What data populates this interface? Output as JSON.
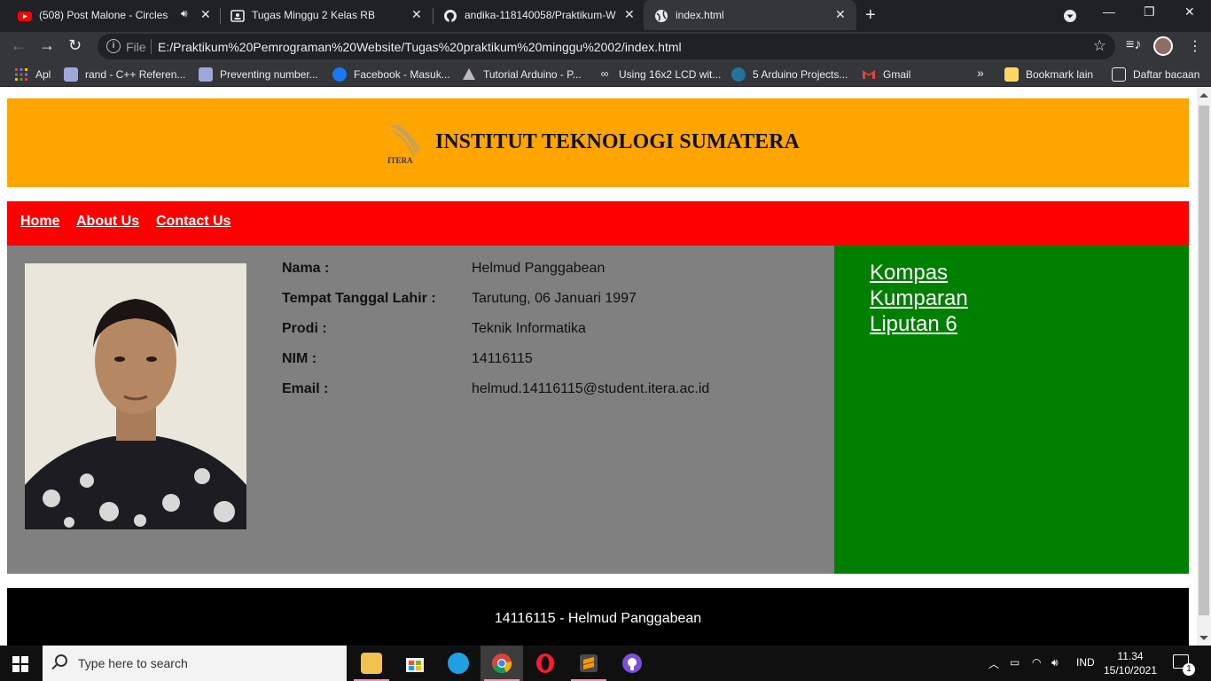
{
  "browser": {
    "tabs": [
      {
        "title": "(508) Post Malone - Circles -",
        "icon": "youtube-icon",
        "audio": true
      },
      {
        "title": "Tugas Minggu 2 Kelas RB",
        "icon": "classroom-icon"
      },
      {
        "title": "andika-118140058/Praktikum-W",
        "icon": "github-icon"
      },
      {
        "title": "index.html",
        "icon": "globe-icon",
        "active": true
      }
    ],
    "omnibox": {
      "scheme": "File",
      "url": "E:/Praktikum%20Pemrograman%20Website/Tugas%20praktikum%20minggu%2002/index.html"
    },
    "bookmarks": [
      {
        "label": "Apl",
        "icon": "apps-grid-icon"
      },
      {
        "label": "rand - C++ Referen...",
        "icon": "cplusplus-icon"
      },
      {
        "label": "Preventing number...",
        "icon": "cplusplus-icon"
      },
      {
        "label": "Facebook - Masuk...",
        "icon": "facebook-icon"
      },
      {
        "label": "Tutorial Arduino - P...",
        "icon": "arduino-icon"
      },
      {
        "label": "Using 16x2 LCD wit...",
        "icon": "link-icon"
      },
      {
        "label": "5 Arduino Projects...",
        "icon": "wordpress-icon"
      },
      {
        "label": "Gmail",
        "icon": "gmail-icon"
      }
    ],
    "bookmarks_overflow": "»",
    "bookmark_folder": "Bookmark lain",
    "reading_list": "Daftar bacaan"
  },
  "page": {
    "header_title": "INSTITUT TEKNOLOGI SUMATERA",
    "logo_text": "ITERA",
    "nav": [
      "Home",
      "About Us",
      "Contact Us"
    ],
    "bio": [
      {
        "label": "Nama :",
        "value": "Helmud Panggabean"
      },
      {
        "label": "Tempat Tanggal Lahir :",
        "value": "Tarutung, 06 Januari 1997"
      },
      {
        "label": "Prodi :",
        "value": "Teknik Informatika"
      },
      {
        "label": "NIM :",
        "value": "14116115"
      },
      {
        "label": "Email :",
        "value": "helmud.14116115@student.itera.ac.id"
      }
    ],
    "links": [
      "Kompas",
      "Kumparan",
      "Liputan 6"
    ],
    "footer": "14116115 - Helmud Panggabean",
    "colors": {
      "header": "#ffa500",
      "nav": "#ff0000",
      "main": "#808080",
      "aside": "#008000",
      "footer": "#000000"
    }
  },
  "taskbar": {
    "search_placeholder": "Type here to search",
    "apps": [
      "file-explorer-icon",
      "store-icon",
      "edge-icon",
      "chrome-icon",
      "opera-icon",
      "sublime-text-icon",
      "github-desktop-icon"
    ],
    "language": "IND",
    "time": "11.34",
    "date": "15/10/2021",
    "notifications": "1"
  }
}
